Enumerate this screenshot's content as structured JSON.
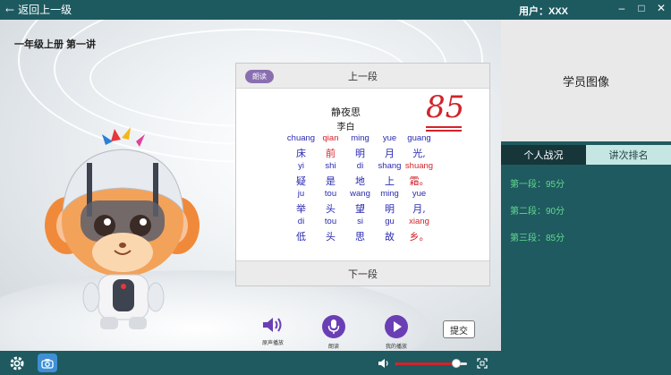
{
  "titlebar": {
    "back_label": "返回上一级",
    "user_label": "用户：XXX"
  },
  "lesson": {
    "title": "一年级上册 第一讲"
  },
  "reader": {
    "badge": "朗读",
    "prev_label": "上一段",
    "next_label": "下一段",
    "score": "85",
    "poem_title": "静夜思",
    "poem_author": "李白",
    "lines": [
      {
        "pinyin": [
          "chuang",
          "qian",
          "ming",
          "yue",
          "guang"
        ],
        "hanzi": [
          "床",
          "前",
          "明",
          "月",
          "光,"
        ],
        "red": [
          1
        ]
      },
      {
        "pinyin": [
          "yi",
          "shi",
          "di",
          "shang",
          "shuang"
        ],
        "hanzi": [
          "疑",
          "是",
          "地",
          "上",
          "霜。"
        ],
        "red": [
          4
        ]
      },
      {
        "pinyin": [
          "ju",
          "tou",
          "wang",
          "ming",
          "yue"
        ],
        "hanzi": [
          "举",
          "头",
          "望",
          "明",
          "月,"
        ],
        "red": []
      },
      {
        "pinyin": [
          "di",
          "tou",
          "si",
          "gu",
          "xiang"
        ],
        "hanzi": [
          "低",
          "头",
          "思",
          "故",
          "乡。"
        ],
        "red": [
          4
        ]
      }
    ]
  },
  "controls": {
    "speaker_label": "原声播放",
    "record_label": "朗读",
    "play_label": "我的播放",
    "submit_label": "提交"
  },
  "bottombar": {
    "volume_level": 0.85
  },
  "sidebar": {
    "avatar_label": "学员图像",
    "tabs": [
      "个人战况",
      "讲次排名"
    ],
    "scores": [
      "第一段：95分",
      "第二段：90分",
      "第三段：85分"
    ]
  },
  "colors": {
    "teal": "#1f5a60",
    "score_red": "#d2232a",
    "pinyin_blue": "#2a2ab0",
    "score_green": "#62d98f",
    "accent_purple": "#6a3fb5"
  }
}
